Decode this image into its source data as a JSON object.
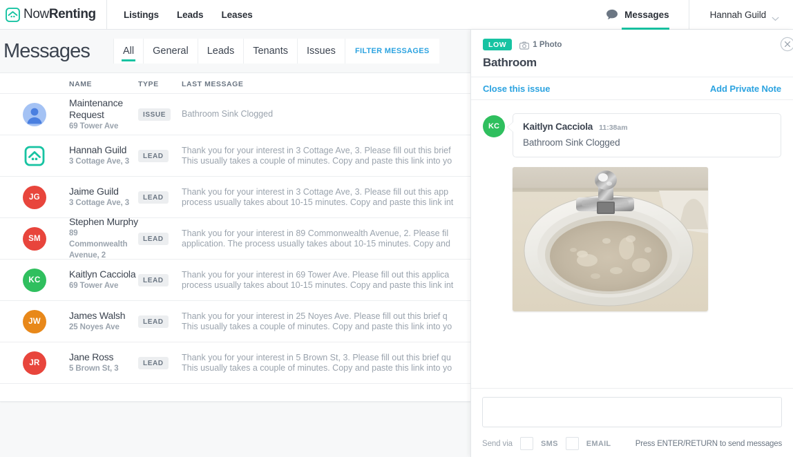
{
  "brand": {
    "light": "Now",
    "bold": "Renting",
    "logo_icon": "house-logo-icon"
  },
  "topnav": {
    "links": [
      {
        "label": "Listings"
      },
      {
        "label": "Leads"
      },
      {
        "label": "Leases"
      }
    ],
    "messages": {
      "label": "Messages",
      "icon": "chat-bubble-icon",
      "active": true
    },
    "user": {
      "label": "Hannah Guild",
      "icon": "chevron-down-icon"
    }
  },
  "page": {
    "title": "Messages",
    "tabs": [
      {
        "label": "All",
        "active": true
      },
      {
        "label": "General",
        "active": false
      },
      {
        "label": "Leads",
        "active": false
      },
      {
        "label": "Tenants",
        "active": false
      },
      {
        "label": "Issues",
        "active": false
      }
    ],
    "filter_label": "FILTER MESSAGES"
  },
  "list": {
    "columns": {
      "name": "NAME",
      "type": "TYPE",
      "last_message": "LAST MESSAGE"
    },
    "rows": [
      {
        "name": "Maintenance Request",
        "sub": "69 Tower Ave",
        "type": "ISSUE",
        "avatar": {
          "kind": "person",
          "initials": "",
          "color": "#a4c2f4"
        },
        "last_line1": "Bathroom Sink Clogged",
        "last_line2": ""
      },
      {
        "name": "Hannah Guild",
        "sub": "3 Cottage Ave, 3",
        "type": "LEAD",
        "avatar": {
          "kind": "house",
          "initials": "",
          "color": "#17c3a2"
        },
        "last_line1": "Thank you for your interest in 3 Cottage Ave, 3. Please fill out this brief",
        "last_line2": "This usually takes a couple of minutes. Copy and paste this link into yo"
      },
      {
        "name": "Jaime Guild",
        "sub": "3 Cottage Ave, 3",
        "type": "LEAD",
        "avatar": {
          "kind": "initials",
          "initials": "JG",
          "color": "#e8453c"
        },
        "last_line1": "Thank you for your interest in 3 Cottage Ave, 3. Please fill out this app",
        "last_line2": "process usually takes about 10-15 minutes. Copy and paste this link int"
      },
      {
        "name": "Stephen Murphy",
        "sub": "89 Commonwealth Avenue, 2",
        "type": "LEAD",
        "avatar": {
          "kind": "initials",
          "initials": "SM",
          "color": "#e8453c"
        },
        "last_line1": "Thank you for your interest in 89 Commonwealth Avenue, 2. Please fil",
        "last_line2": "application. The process usually takes about 10-15 minutes. Copy and"
      },
      {
        "name": "Kaitlyn Cacciola",
        "sub": "69 Tower Ave",
        "type": "LEAD",
        "avatar": {
          "kind": "initials",
          "initials": "KC",
          "color": "#2fbf5e"
        },
        "last_line1": "Thank you for your interest in 69 Tower Ave. Please fill out this applica",
        "last_line2": "process usually takes about 10-15 minutes. Copy and paste this link int"
      },
      {
        "name": "James Walsh",
        "sub": "25 Noyes Ave",
        "type": "LEAD",
        "avatar": {
          "kind": "initials",
          "initials": "JW",
          "color": "#e8881a"
        },
        "last_line1": "Thank you for your interest in 25 Noyes Ave. Please fill out this brief q",
        "last_line2": "This usually takes a couple of minutes. Copy and paste this link into yo"
      },
      {
        "name": "Jane Ross",
        "sub": "5 Brown St, 3",
        "type": "LEAD",
        "avatar": {
          "kind": "initials",
          "initials": "JR",
          "color": "#e8453c"
        },
        "last_line1": "Thank you for your interest in 5 Brown St, 3. Please fill out this brief qu",
        "last_line2": "This usually takes a couple of minutes. Copy and paste this link into yo"
      }
    ]
  },
  "panel": {
    "priority": "LOW",
    "priority_color": "#17c3a2",
    "photo_count": "1 Photo",
    "photo_icon": "camera-icon",
    "title": "Bathroom",
    "close_icon": "close-circle-icon",
    "close_issue_label": "Close this issue",
    "add_note_label": "Add Private Note",
    "message": {
      "author": "Kaitlyn Cacciola",
      "initials": "KC",
      "avatar_color": "#2fbf5e",
      "time": "11:38am",
      "body": "Bathroom Sink Clogged",
      "attachment_alt": "photo-of-clogged-bathroom-sink"
    },
    "compose": {
      "value": "",
      "placeholder": "",
      "send_via_label": "Send via",
      "sms_label": "SMS",
      "email_label": "EMAIL",
      "sms_checked": false,
      "email_checked": false,
      "hint": "Press ENTER/RETURN to send messages"
    }
  }
}
